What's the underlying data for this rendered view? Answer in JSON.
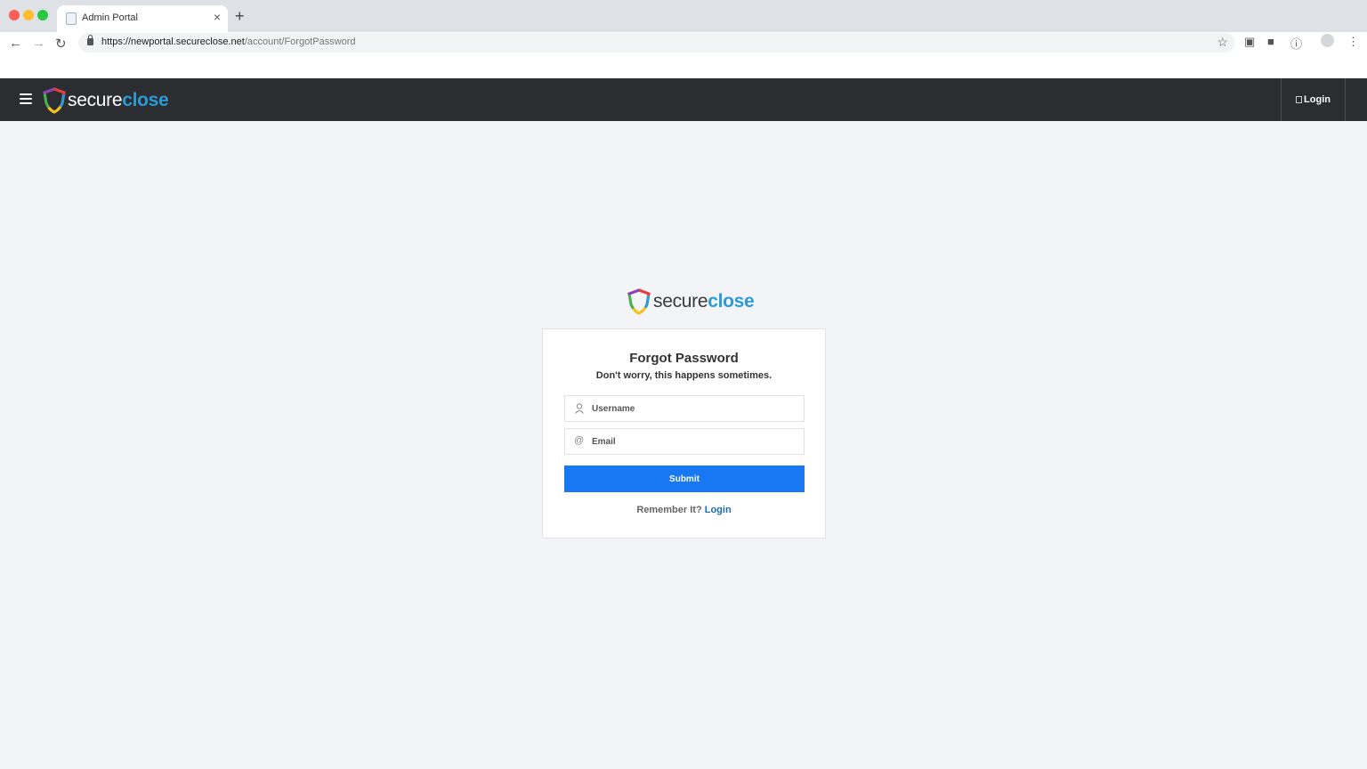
{
  "browser": {
    "tab_title": "Admin Portal",
    "tab_close": "×",
    "new_tab": "+",
    "url_host": "https://newportal.secureclose.net",
    "url_path": "/account/ForgotPassword"
  },
  "header": {
    "logo_secure": "secure",
    "logo_close": "close",
    "login_label": "Login"
  },
  "card": {
    "logo_secure": "secure",
    "logo_close": "close",
    "title": "Forgot Password",
    "subtitle": "Don't worry, this happens sometimes.",
    "username_placeholder": "Username",
    "email_placeholder": "Email",
    "submit_label": "Submit",
    "remember_text": "Remember It?",
    "login_link": "Login"
  },
  "colors": {
    "header_bg": "#2b2d31",
    "accent": "#1877f2",
    "logo_blue": "#2b9bd6",
    "page_bg": "#f3f4f8"
  }
}
